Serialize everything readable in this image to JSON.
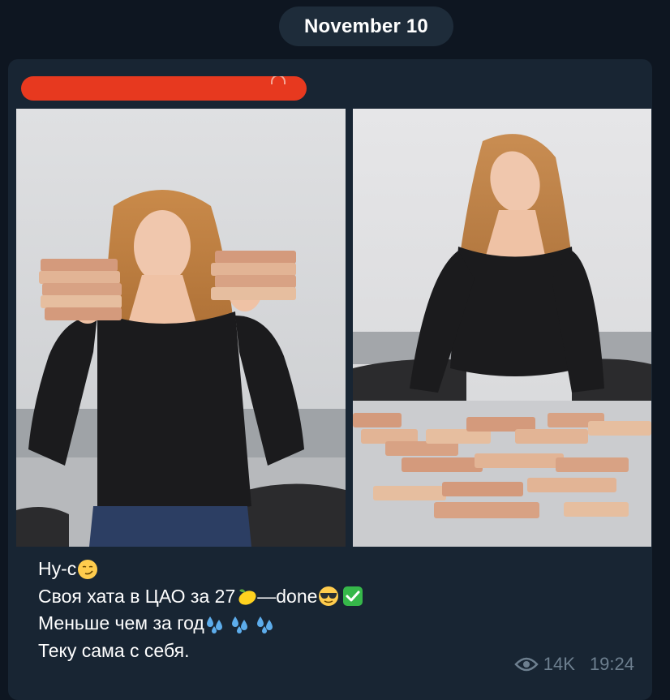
{
  "date_separator": "November 10",
  "channel": {
    "name": "",
    "name_color": "#e7391f"
  },
  "album": {
    "photos": [
      {
        "description": "photo-1"
      },
      {
        "description": "photo-2"
      }
    ]
  },
  "caption": {
    "line1": "Ну-с",
    "line2_a": "Своя хата в ЦАО за 27",
    "line2_b": "—done",
    "line3": "Меньше чем за год",
    "line4": "Теку сама с себя."
  },
  "icons": {
    "line1": [
      "smirking-face"
    ],
    "line2": [
      "lemon",
      "smiling-face-with-sunglasses",
      "check-mark-button"
    ],
    "line3": [
      "sweat-droplets",
      "sweat-droplets",
      "sweat-droplets"
    ],
    "meta": [
      "eye-icon"
    ]
  },
  "meta": {
    "views": "14K",
    "time": "19:24"
  },
  "colors": {
    "background": "#0e1621",
    "bubble": "#182533",
    "date_pill": "#1e2c3a",
    "meta_text": "#6d7f8f"
  }
}
